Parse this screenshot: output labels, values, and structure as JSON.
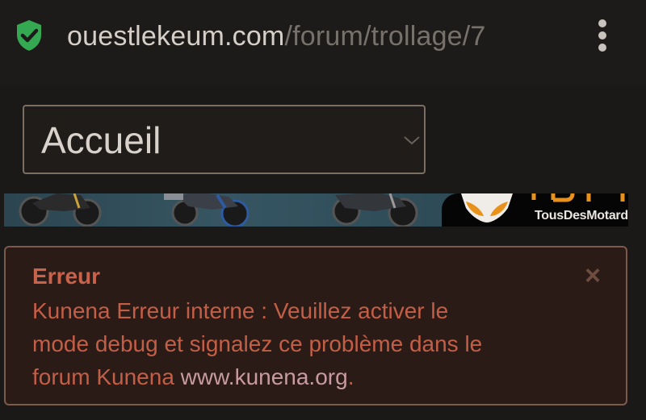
{
  "browser": {
    "url_host": "ouestlekeum.com",
    "url_path": "/forum/trollage/7",
    "secure_icon": "shield-check-icon",
    "menu_icon": "kebab-menu-icon"
  },
  "nav": {
    "selected": "Accueil",
    "dropdown_icon": "chevron-down-icon"
  },
  "banner": {
    "brand_text": "TousDesMotards",
    "logo_letters": "TDM"
  },
  "alert": {
    "title": "Erreur",
    "message_lines": [
      "Kunena Erreur interne : Veuillez activer le",
      "mode debug et signalez ce problème dans le",
      "forum Kunena "
    ],
    "link_text": "www.kunena.org",
    "suffix": ".",
    "close_icon": "close-icon"
  },
  "colors": {
    "secure_green": "#35a852",
    "error_text": "#c35e47",
    "link": "#c89aa1"
  }
}
